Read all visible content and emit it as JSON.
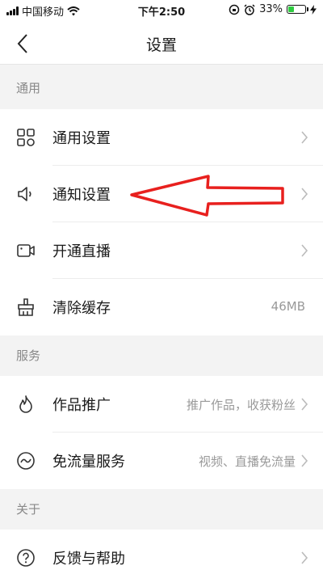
{
  "status_bar": {
    "carrier": "中国移动",
    "time": "下午2:50",
    "battery_percent": "33%",
    "battery_level": 0.33,
    "accent": "#2ecc40"
  },
  "nav": {
    "title": "设置",
    "back_icon": "chevron-left-icon"
  },
  "sections": {
    "general": {
      "header": "通用",
      "items": [
        {
          "label": "通用设置",
          "icon": "grid-icon"
        },
        {
          "label": "通知设置",
          "icon": "speaker-icon"
        },
        {
          "label": "开通直播",
          "icon": "video-camera-icon"
        },
        {
          "label": "清除缓存",
          "icon": "broom-icon",
          "value": "46MB"
        }
      ]
    },
    "services": {
      "header": "服务",
      "items": [
        {
          "label": "作品推广",
          "icon": "flame-icon",
          "value": "推广作品，收获粉丝"
        },
        {
          "label": "免流量服务",
          "icon": "wave-icon",
          "value": "视频、直播免流量"
        }
      ]
    },
    "about": {
      "header": "关于",
      "items": [
        {
          "label": "反馈与帮助",
          "icon": "help-circle-icon"
        }
      ]
    }
  },
  "annotation": {
    "type": "arrow",
    "color": "#e8201e",
    "points_to": "通知设置"
  }
}
